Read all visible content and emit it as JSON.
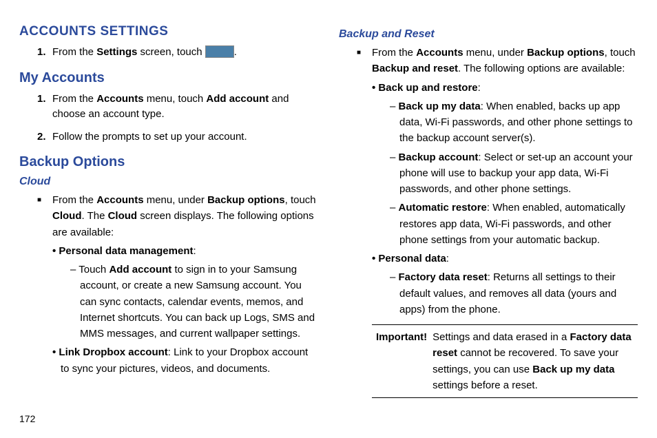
{
  "page_number": "172",
  "h1": "ACCOUNTS SETTINGS",
  "accounts_step1_pre": "From the ",
  "accounts_step1_b1": "Settings",
  "accounts_step1_mid": " screen, touch ",
  "accounts_step1_post": ".",
  "h2_myaccounts": "My Accounts",
  "my1_pre": "From the ",
  "my1_b1": "Accounts",
  "my1_mid": " menu, touch ",
  "my1_b2": "Add account",
  "my1_post": " and choose an account type.",
  "my2": "Follow the prompts to set up your account.",
  "h2_backup": "Backup Options",
  "h3_cloud": "Cloud",
  "cloud_intro_pre": "From the ",
  "cloud_intro_b1": "Accounts",
  "cloud_intro_mid1": " menu, under ",
  "cloud_intro_b2": "Backup options",
  "cloud_intro_mid2": ", touch ",
  "cloud_intro_b3": "Cloud",
  "cloud_intro_mid3": ". The ",
  "cloud_intro_b4": "Cloud",
  "cloud_intro_post": " screen displays. The following options are available:",
  "pdm_b": "Personal data management",
  "pdm_colon": ":",
  "pdm_d1_pre": "Touch ",
  "pdm_d1_b": "Add account",
  "pdm_d1_post": " to sign in to your Samsung account, or create a new Samsung account. You can sync contacts, calendar events, memos, and Internet shortcuts. You can back up Logs, SMS and MMS messages, and current wallpaper settings.",
  "ldb_b": "Link Dropbox account",
  "ldb_post": ": Link to your Dropbox account to sync your pictures, videos, and documents.",
  "h3_bar": "Backup and Reset",
  "bar_intro_pre": "From the ",
  "bar_intro_b1": "Accounts",
  "bar_intro_mid1": " menu, under ",
  "bar_intro_b2": "Backup options",
  "bar_intro_mid2": ", touch ",
  "bar_intro_b3": "Backup and reset",
  "bar_intro_post": ". The following options are available:",
  "bur_b": "Back up and restore",
  "bur_colon": ":",
  "bumd_b": "Back up my data",
  "bumd_post": ": When enabled, backs up app data, Wi-Fi passwords, and other phone settings to the backup account server(s).",
  "bacc_b": "Backup account",
  "bacc_post": ": Select or set-up an account your phone will use to backup your app data, Wi-Fi passwords, and other phone settings.",
  "arest_b": "Automatic restore",
  "arest_post": ": When enabled, automatically restores app data, Wi-Fi passwords, and other phone settings from your automatic backup.",
  "pd_b": "Personal data",
  "pd_colon": ":",
  "fdr_b": "Factory data reset",
  "fdr_post": ": Returns all settings to their default values, and removes all data (yours and apps) from the phone.",
  "imp_label": "Important!",
  "imp_t1": "Settings and data erased in a ",
  "imp_b1": "Factory data reset",
  "imp_t2": " cannot be recovered. To save your settings, you can use ",
  "imp_b2": "Back up my data",
  "imp_t3": " settings before a reset.",
  "num1": "1.",
  "num2": "2."
}
